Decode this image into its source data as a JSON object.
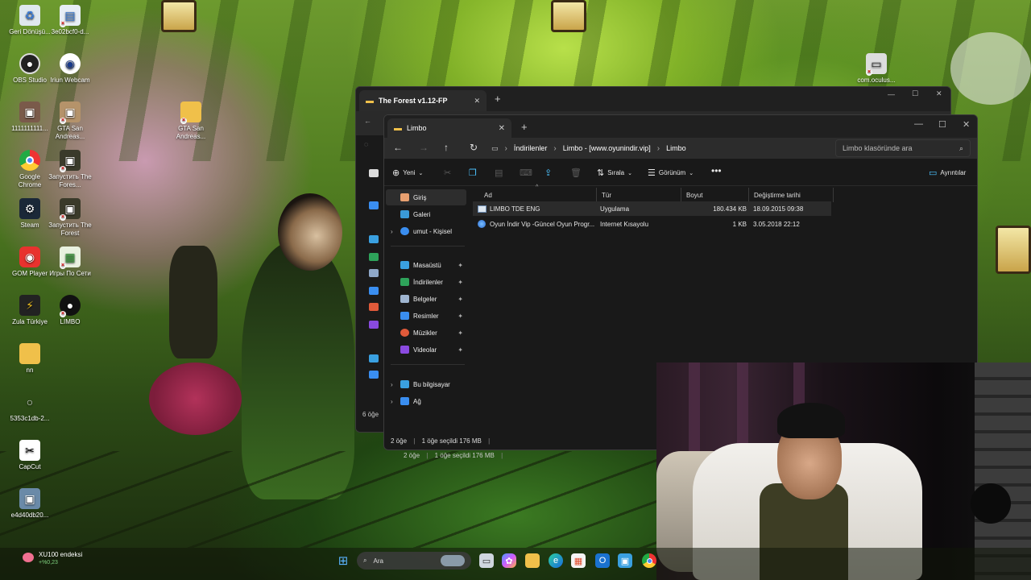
{
  "desktop": {
    "icons": [
      {
        "label": "Geri Dönüşü...",
        "icon": "recycle-bin-icon"
      },
      {
        "label": "3e02bcf0-d...",
        "icon": "document-icon"
      },
      {
        "label": "OBS Studio",
        "icon": "obs-icon"
      },
      {
        "label": "Iriun Webcam",
        "icon": "webcam-icon"
      },
      {
        "label": "1111111111...",
        "icon": "image-icon"
      },
      {
        "label": "GTA San Andreas...",
        "icon": "gta-icon"
      },
      {
        "label": "GTA San Andreas...",
        "icon": "folder-icon"
      },
      {
        "label": "Google Chrome",
        "icon": "chrome-icon"
      },
      {
        "label": "Запустить The Fores...",
        "icon": "game-icon"
      },
      {
        "label": "Steam",
        "icon": "steam-icon"
      },
      {
        "label": "Запустить The Forest",
        "icon": "game-icon"
      },
      {
        "label": "GOM Player",
        "icon": "gom-icon"
      },
      {
        "label": "Игры По Сети",
        "icon": "games-icon"
      },
      {
        "label": "Zula Türkiye",
        "icon": "zula-icon"
      },
      {
        "label": "LIMBO",
        "icon": "limbo-icon"
      },
      {
        "label": "nn",
        "icon": "folder-icon"
      },
      {
        "label": "5353c1db-2...",
        "icon": "document-icon"
      },
      {
        "label": "CapCut",
        "icon": "capcut-icon"
      },
      {
        "label": "e4d40db20...",
        "icon": "image-icon"
      },
      {
        "label": "com.oculus...",
        "icon": "oculus-icon"
      }
    ]
  },
  "back_window": {
    "tab_title": "The Forest v1.12-FP",
    "status_count": "6 öğe",
    "status_text": "2 öğe",
    "status_selected": "1 öğe seçildi  176 MB"
  },
  "window": {
    "tab_title": "Limbo",
    "breadcrumb": [
      "İndirilenler",
      "Limbo - [www.oyunindir.vip]",
      "Limbo"
    ],
    "search_placeholder": "Limbo klasöründe ara",
    "toolbar": {
      "new_label": "Yeni",
      "sort_label": "Sırala",
      "view_label": "Görünüm",
      "details_label": "Ayrıntılar"
    },
    "nav": {
      "home": "Giriş",
      "gallery": "Galeri",
      "onedrive": "umut - Kişisel",
      "pinned": [
        "Masaüstü",
        "İndirilenler",
        "Belgeler",
        "Resimler",
        "Müzikler",
        "Videolar"
      ],
      "this_pc": "Bu bilgisayar",
      "network": "Ağ"
    },
    "columns": [
      "Ad",
      "Tür",
      "Boyut",
      "Değiştirme tarihi"
    ],
    "files": [
      {
        "name": "LIMBO TDE ENG",
        "type": "Uygulama",
        "size": "180.434 KB",
        "date": "18.09.2015 09:38",
        "icon": "application-icon"
      },
      {
        "name": "Oyun İndir Vip -Güncel Oyun Progr...",
        "type": "Internet Kısayolu",
        "size": "1 KB",
        "date": "3.05.2018 22:12",
        "icon": "internet-shortcut-icon"
      }
    ],
    "status_count": "2 öğe",
    "status_selected": "1 öğe seçildi  176 MB"
  },
  "taskbar": {
    "widget_name": "XU100 endeksi",
    "widget_value": "+%0,23",
    "search_label": "Ara",
    "icons": [
      "windows-start-icon",
      "task-view-icon",
      "copilot-icon",
      "file-explorer-icon",
      "edge-icon",
      "store-icon",
      "outlook-icon",
      "photos-icon",
      "chrome-icon"
    ]
  },
  "colors": {
    "accent": "#4cc2ff",
    "folder": "#f0c04a",
    "error_badge": "#d11a2a"
  }
}
